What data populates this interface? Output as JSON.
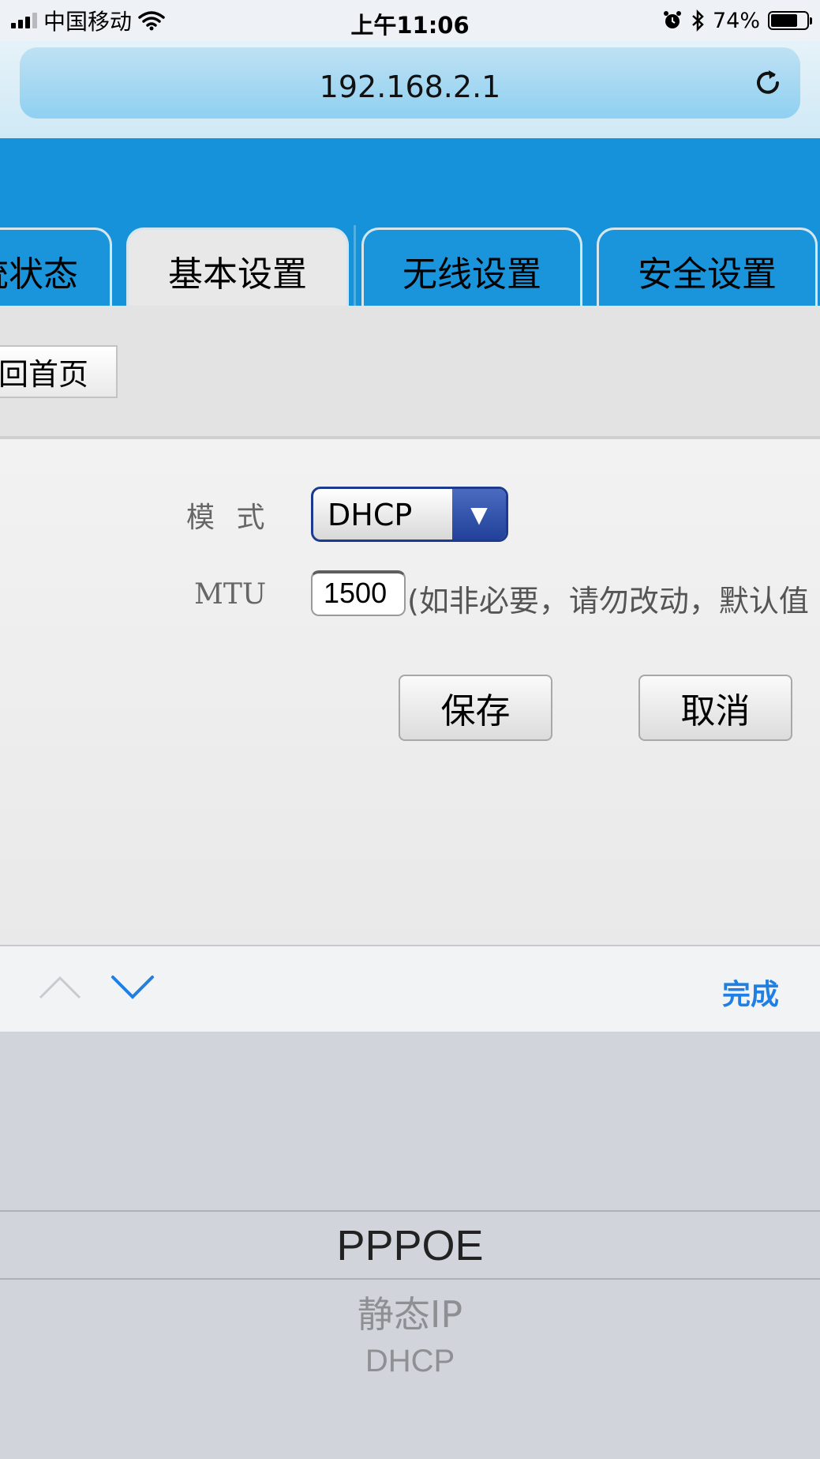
{
  "status_bar": {
    "carrier": "中国移动",
    "time": "上午11:06",
    "battery": "74%",
    "battery_level": 0.74,
    "icons": [
      "signal-icon",
      "wifi-icon",
      "alarm-icon",
      "bluetooth-icon",
      "battery-icon"
    ]
  },
  "browser": {
    "url": "192.168.2.1",
    "reload_icon": "reload-icon"
  },
  "tabs": [
    {
      "label": "统状态"
    },
    {
      "label": "基本设置",
      "active": true
    },
    {
      "label": "无线设置"
    },
    {
      "label": "安全设置"
    }
  ],
  "subnav": {
    "home_label": "回首页"
  },
  "form": {
    "mode_label": "模 式",
    "mode_value": "DHCP",
    "mtu_label": "MTU",
    "mtu_value": "1500",
    "mtu_hint": "(如非必要，请勿改动，默认值",
    "save_label": "保存",
    "cancel_label": "取消"
  },
  "accessory": {
    "done_label": "完成"
  },
  "picker": {
    "options": [
      "PPPOE",
      "静态IP",
      "DHCP"
    ],
    "selected": "PPPOE"
  },
  "colors": {
    "header_blue": "#1592d9",
    "select_border": "#1d3a8f",
    "done_blue": "#1f7fe2"
  }
}
